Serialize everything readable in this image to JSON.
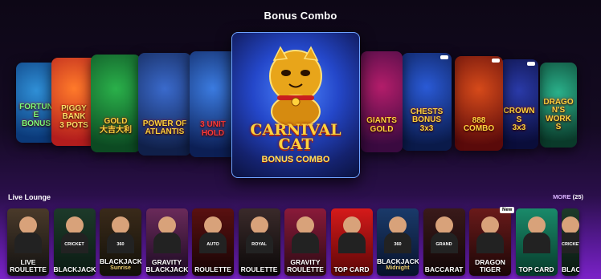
{
  "section": {
    "title": "Bonus Combo"
  },
  "carousel": {
    "slides": [
      {
        "label": "FORTUNE\nBONUS",
        "c1": "#2f8fd6",
        "c2": "#0b3a7a",
        "accent": "#7cff7c"
      },
      {
        "label": "PIGGY\nBANK\n3 POTS",
        "c1": "#ff7a2a",
        "c2": "#b31d1d",
        "accent": "#ffe066"
      },
      {
        "label": "GOLD\n大吉大利",
        "c1": "#2ab04a",
        "c2": "#0c4a22",
        "accent": "#ffd23d"
      },
      {
        "label": "POWER OF\nATLANTIS",
        "c1": "#3a6acc",
        "c2": "#10204a",
        "accent": "#ffd23d"
      },
      {
        "label": "3 UNIT\nHOLD",
        "c1": "#3b7be0",
        "c2": "#0c1f55",
        "accent": "#ff3a3a"
      },
      {
        "label": "GIANTS\nGOLD",
        "c1": "#b31d6a",
        "c2": "#3a0a40",
        "accent": "#ffd23d"
      },
      {
        "label": "CHESTS\nBONUS 3x3",
        "c1": "#2a5ad6",
        "c2": "#0a1a4a",
        "accent": "#ffd23d"
      },
      {
        "label": "888\nCOMBO",
        "c1": "#d64a1a",
        "c2": "#5a0a0a",
        "accent": "#ffd23d"
      },
      {
        "label": "CROWNS\n3x3",
        "c1": "#2a3aa8",
        "c2": "#0a0d3a",
        "accent": "#ffd23d"
      },
      {
        "label": "DRAGON'S\nWORKS",
        "c1": "#2ab08a",
        "c2": "#0a3a2a",
        "accent": "#ffd23d"
      }
    ],
    "featured": {
      "title": "CARNIVAL CAT",
      "subtitle": "BONUS COMBO"
    }
  },
  "live_lounge": {
    "title": "Live Lounge",
    "more_label": "MORE",
    "more_count": "(25)",
    "tiles": [
      {
        "top": "",
        "label": "LIVE\nROULETTE",
        "sub": "",
        "bg1": "#4a3a2a",
        "bg2": "#111",
        "badge": ""
      },
      {
        "top": "CRICKET",
        "label": "BLACKJACK",
        "sub": "",
        "bg1": "#1d3a2a",
        "bg2": "#0a1a12",
        "badge": ""
      },
      {
        "top": "360",
        "label": "BLACKJACK",
        "sub": "Sunrise",
        "bg1": "#3a2a1a",
        "bg2": "#121008",
        "badge": ""
      },
      {
        "top": "",
        "label": "GRAVITY\nBLACKJACK",
        "sub": "",
        "bg1": "#6a2a5a",
        "bg2": "#1a0a22",
        "badge": ""
      },
      {
        "top": "AUTO",
        "label": "ROULETTE",
        "sub": "",
        "bg1": "#5a1010",
        "bg2": "#150404",
        "badge": ""
      },
      {
        "top": "ROYAL",
        "label": "ROULETTE",
        "sub": "",
        "bg1": "#3a2a2a",
        "bg2": "#0a0808",
        "badge": ""
      },
      {
        "top": "",
        "label": "GRAVITY\nROULETTE",
        "sub": "",
        "bg1": "#8a1a3a",
        "bg2": "#2a0a12",
        "badge": ""
      },
      {
        "top": "",
        "label": "TOP CARD",
        "sub": "",
        "bg1": "#d61a1a",
        "bg2": "#5a0606",
        "badge": ""
      },
      {
        "top": "360",
        "label": "BLACKJACK",
        "sub": "Midnight",
        "bg1": "#1a3a6a",
        "bg2": "#08122a",
        "badge": ""
      },
      {
        "top": "GRAND",
        "label": "BACCARAT",
        "sub": "",
        "bg1": "#3a1a1a",
        "bg2": "#100606",
        "badge": ""
      },
      {
        "top": "",
        "label": "DRAGON\nTIGER",
        "sub": "",
        "bg1": "#6a1a1a",
        "bg2": "#1a0606",
        "badge": "New"
      },
      {
        "top": "",
        "label": "TOP CARD",
        "sub": "",
        "bg1": "#1a8a6a",
        "bg2": "#063a2a",
        "badge": ""
      },
      {
        "top": "CRICKET",
        "label": "BLACK",
        "sub": "",
        "bg1": "#1d3a2a",
        "bg2": "#0a1a12",
        "badge": ""
      }
    ]
  }
}
